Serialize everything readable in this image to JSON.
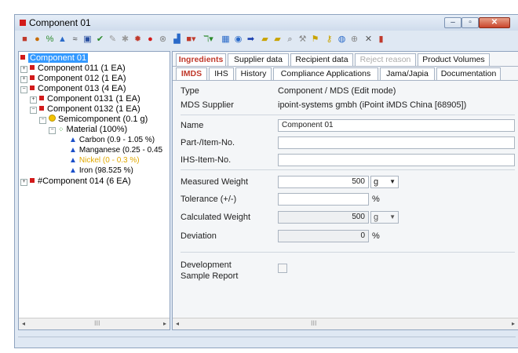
{
  "window": {
    "title": "Component 01"
  },
  "toolbar": {
    "icons": [
      "save-icon",
      "search-icon",
      "link-icon",
      "warning-icon",
      "transfer-icon",
      "print-icon",
      "check-icon",
      "edit-icon",
      "pin-icon",
      "stop-icon",
      "record-icon",
      "settings-icon",
      "chart-icon",
      "color-icon",
      "tree-icon",
      "grid-icon",
      "doc-icon",
      "arrow-right-icon",
      "folder-icon",
      "folder-open-icon",
      "find-icon",
      "tools-icon",
      "flag-icon",
      "key-icon",
      "globe-icon",
      "info-icon",
      "close-icon",
      "export-icon"
    ]
  },
  "tree": {
    "items": [
      {
        "label": "Component 01",
        "selected": true
      },
      {
        "label": "Component 011 (1 EA)"
      },
      {
        "label": "Component 012 (1 EA)"
      },
      {
        "label": "Component 013 (4 EA)"
      },
      {
        "label": "Component 0131 (1 EA)"
      },
      {
        "label": "Component 0132 (1 EA)"
      },
      {
        "label": "Semicomponent (0.1 g)"
      },
      {
        "label": "Material (100%)"
      },
      {
        "label": "Carbon (0.9 - 1.05 %)"
      },
      {
        "label": "Manganese (0.25 - 0.45"
      },
      {
        "label": "Nickel (0 - 0.3 %)"
      },
      {
        "label": "Iron (98.525 %)"
      },
      {
        "label": "#Component 014 (6 EA)"
      }
    ],
    "scroll_grip": "III"
  },
  "tabs_top": [
    {
      "label": "Ingredients",
      "state": "active"
    },
    {
      "label": "Supplier data"
    },
    {
      "label": "Recipient data"
    },
    {
      "label": "Reject reason",
      "state": "disabled"
    },
    {
      "label": "Product Volumes"
    }
  ],
  "tabs_sub": [
    {
      "label": "IMDS",
      "state": "active"
    },
    {
      "label": "IHS"
    },
    {
      "label": "History"
    },
    {
      "label": "Compliance Applications"
    },
    {
      "label": "Jama/Japia"
    },
    {
      "label": "Documentation"
    }
  ],
  "form": {
    "type_label": "Type",
    "type_value": "Component / MDS (Edit mode)",
    "supplier_label": "MDS Supplier",
    "supplier_value": "ipoint-systems gmbh (iPoint iMDS China [68905])",
    "name_label": "Name",
    "name_value": "Component 01",
    "part_label": "Part-/Item-No.",
    "part_value": "",
    "ihs_label": "IHS-Item-No.",
    "ihs_value": "",
    "measured_label": "Measured Weight",
    "measured_value": "500",
    "measured_unit": "g",
    "tolerance_label": "Tolerance (+/-)",
    "tolerance_value": "",
    "tolerance_unit": "%",
    "calculated_label": "Calculated Weight",
    "calculated_value": "500",
    "calculated_unit": "g",
    "deviation_label": "Deviation",
    "deviation_value": "0",
    "deviation_unit": "%",
    "dev_sample_label_1": "Development",
    "dev_sample_label_2": "Sample Report",
    "dev_sample_checked": false
  },
  "right_scroll_grip": "III",
  "colors": {
    "accent_red": "#c0392b",
    "selection_blue": "#3399ff",
    "frame": "#8ea3bf"
  }
}
